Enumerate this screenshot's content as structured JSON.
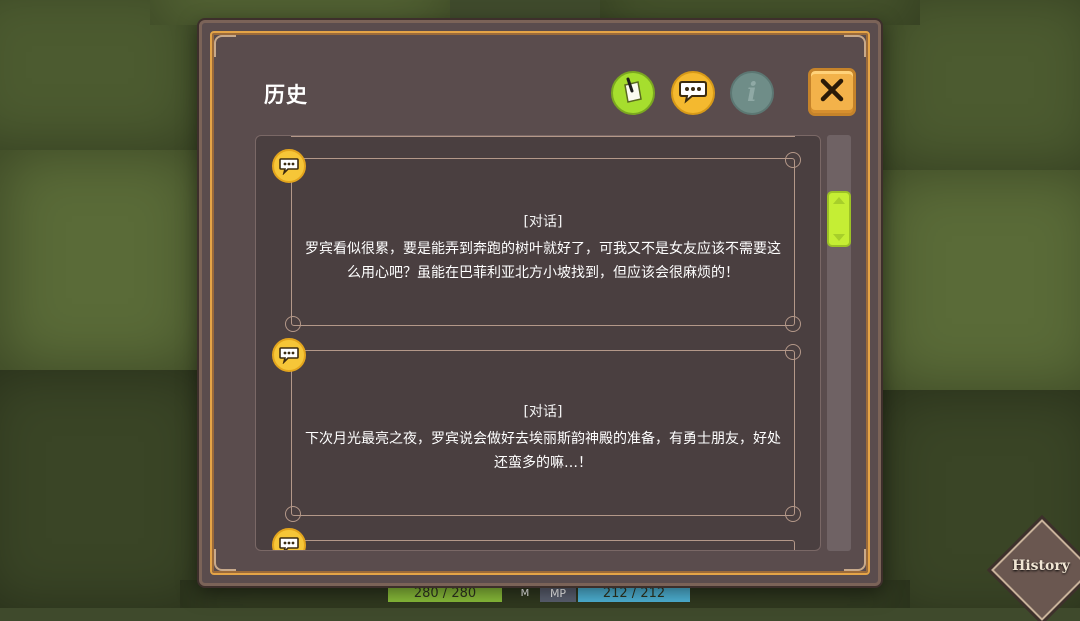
{
  "dialog": {
    "title": "历史",
    "toolbar": {
      "note_icon": "note-paper-icon",
      "chat_icon": "chat-bubble-icon",
      "info_icon": "info-icon",
      "info_glyph": "i",
      "close_icon": "close-icon"
    },
    "entries": [
      {
        "tag": "[对话]",
        "text": "罗宾看似很累，要是能弄到奔跑的树叶就好了，可我又不是女友应该不需要这么用心吧？虽能在巴菲利亚北方小坡找到，但应该会很麻烦的！"
      },
      {
        "tag": "[对话]",
        "text": "下次月光最亮之夜，罗宾说会做好去埃丽斯韵神殿的准备，有勇士朋友，好处还蛮多的嘛…！"
      }
    ]
  },
  "hud": {
    "hp_text": "280 / 280",
    "m_label": "M",
    "mp_label": "MP",
    "mp_text": "212 / 212"
  },
  "history_button": {
    "label": "History"
  },
  "colors": {
    "panel": "#5a4c4d",
    "frame_gold": "#e4a447",
    "accent_green": "#c5ee34",
    "accent_yellow": "#f4b92f",
    "close_orange": "#f3b24a"
  }
}
